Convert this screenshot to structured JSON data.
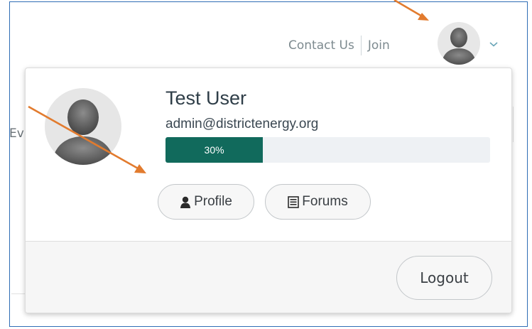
{
  "header": {
    "contact_label": "Contact Us",
    "join_label": "Join"
  },
  "background": {
    "partial_text": "Ev"
  },
  "user_menu": {
    "name": "Test User",
    "email": "admin@districtenergy.org",
    "progress": {
      "percent": 30,
      "label": "30%"
    },
    "profile_label": "Profile",
    "forums_label": "Forums",
    "logout_label": "Logout"
  },
  "icons": {
    "avatar": "user-avatar-icon",
    "chevron": "chevron-down-icon",
    "profile": "person-icon",
    "forums": "list-icon"
  },
  "colors": {
    "progress_fill": "#116a5c",
    "annotation_arrow": "#e27b2e",
    "frame_border": "#2f6db5"
  }
}
